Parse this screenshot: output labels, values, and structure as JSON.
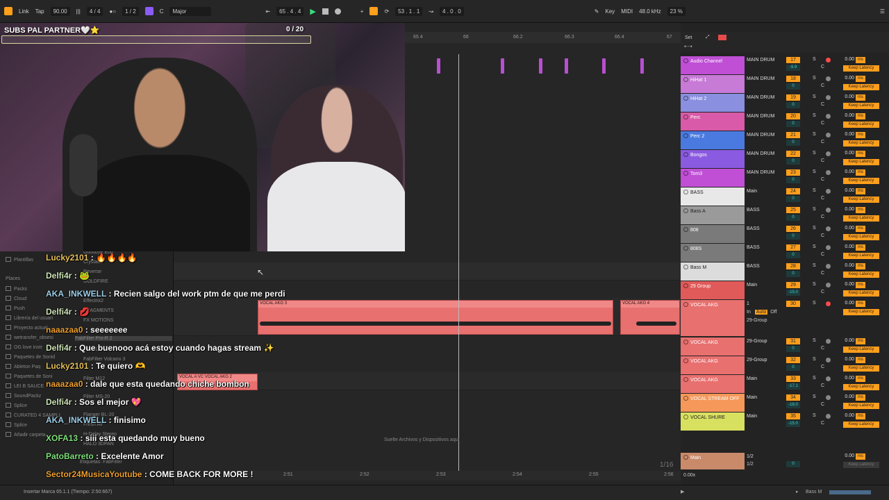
{
  "topbar": {
    "link": "Link",
    "tap": "Tap",
    "tempo": "90.00",
    "time_sig": "4 / 4",
    "quantize": "1 / 2",
    "key": "C",
    "scale": "Major",
    "position": "65 .  4 .  4",
    "loop_start": "53 .  1 .  1",
    "loop_length": "4 .  0 .  0",
    "key_label": "Key",
    "midi_label": "MIDI",
    "sample_rate": "48.0 kHz",
    "cpu": "23 %"
  },
  "webcam": {
    "subs_title": "SUBS PAL PARTNER🤍⭐",
    "subs_count": "0  / 20"
  },
  "ruler": {
    "ticks": [
      "65.4",
      "66",
      "66.2",
      "66.3",
      "66.4",
      "67"
    ],
    "bottom_ticks": [
      "2:51",
      "2:52",
      "2:53",
      "2:54",
      "2:55",
      "2:56"
    ]
  },
  "browser": {
    "items": [
      "Plantillas",
      "Places",
      "Packs",
      "Cloud",
      "Push",
      "Librería del usuari",
      "Proyecto actual",
      "wetransfer_obsesi",
      "OG love instr",
      "Paquetes de Sonid",
      "Ableton Paq",
      "Paquetes de Soni",
      "LEI B SAUCE",
      "SoundPackz",
      "Splice",
      "CURATED 4 SAMPLI",
      "Splice",
      "Añadir carpeta..."
    ],
    "subitems": [
      "Goodbye Ebb",
      "Crystallix",
      "Reverse",
      "GOLDFIRE",
      "Effectrix2",
      "FRAGMENTS",
      "FX MOTIONS",
      "FabFilter Pro-R 2",
      "Filter L",
      "FabFilter Volcano 3",
      "Filter M12",
      "Filter MS-20",
      "Flanger BL-20",
      "Fresh Air",
      "H-Delay Stereo",
      "HALO 3DPAN",
      "Etiquetas: FabFilter"
    ]
  },
  "arrangement": {
    "drop_hint": "Suelte Archivos y Dispositivos aquí",
    "quantize_display": "1/16",
    "clips": [
      "VOCAL AKG 3",
      "VOCAL AKG 4",
      "VOCAL A VC VOCAL AKG 2"
    ]
  },
  "mixer": {
    "set_label": "Set",
    "channels": [
      {
        "name": "Audio Channel",
        "route": "MAIN DRUM",
        "num": "17",
        "val": "-9.9",
        "db": "0.00",
        "lat": "Keep Latency",
        "color": "#c04fd6",
        "arm": true
      },
      {
        "name": "HiHat 1",
        "route": "MAIN DRUM",
        "num": "18",
        "val": "0",
        "db": "0.00",
        "lat": "Keep Latency",
        "color": "#c77ad6",
        "arm": false
      },
      {
        "name": "HiHat 2",
        "route": "MAIN DRUM",
        "num": "19",
        "val": "0",
        "db": "0.00",
        "lat": "Keep Latency",
        "color": "#8a8fe0",
        "arm": false
      },
      {
        "name": "Perc",
        "route": "MAIN DRUM",
        "num": "20",
        "val": "0",
        "db": "0.00",
        "lat": "Keep Latency",
        "color": "#d85aa8",
        "arm": false
      },
      {
        "name": "Perc 2",
        "route": "MAIN DRUM",
        "num": "21",
        "val": "0",
        "db": "0.00",
        "lat": "Keep Latency",
        "color": "#4a7ae0",
        "arm": false
      },
      {
        "name": "Bongos",
        "route": "MAIN DRUM",
        "num": "22",
        "val": "0",
        "db": "0.00",
        "lat": "Keep Latency",
        "color": "#8a5ae0",
        "arm": false
      },
      {
        "name": "Tom3",
        "route": "MAIN DRUM",
        "num": "23",
        "val": "0",
        "db": "0.00",
        "lat": "Keep Latency",
        "color": "#c04fd6",
        "arm": false
      },
      {
        "name": "BASS",
        "route": "Main",
        "num": "24",
        "val": "0",
        "db": "0.00",
        "lat": "Keep Latency",
        "color": "#e8e8e8",
        "arm": false
      },
      {
        "name": "Bass A",
        "route": "BASS",
        "num": "25",
        "val": "0",
        "db": "0.00",
        "lat": "Keep Latency",
        "color": "#9a9a9a",
        "arm": false
      },
      {
        "name": "808",
        "route": "BASS",
        "num": "26",
        "val": "0",
        "db": "0.00",
        "lat": "Keep Latency",
        "color": "#7a7a7a",
        "arm": false
      },
      {
        "name": "808S",
        "route": "BASS",
        "num": "27",
        "val": "0",
        "db": "0.00",
        "lat": "Keep Latency",
        "color": "#7a7a7a",
        "arm": false
      },
      {
        "name": "Bass M",
        "route": "BASS",
        "num": "28",
        "val": "0",
        "db": "0.00",
        "lat": "Keep Latency",
        "color": "#dcdcdc",
        "arm": false
      },
      {
        "name": "29 Group",
        "route": "Main",
        "num": "29",
        "val": "-15.0",
        "db": "0.00",
        "lat": "Keep Latency",
        "color": "#e05a5a",
        "arm": false
      }
    ],
    "vocal_channel": {
      "name": "VOCAL AKG",
      "route": "1",
      "num": "30",
      "in_label": "In",
      "auto_label": "Auto",
      "off_label": "Off",
      "group": "29-Group",
      "db": "0.00",
      "lat": "Keep Latency"
    },
    "more_channels": [
      {
        "name": "VOCAL AKG",
        "route": "29-Group",
        "num": "31",
        "val": "0",
        "db": "0.00",
        "lat": "Keep Latency",
        "color": "#e8706f"
      },
      {
        "name": "VOCAL AKG",
        "route": "29-Group",
        "num": "32",
        "val": "0",
        "db": "0.00",
        "lat": "Keep Latency",
        "color": "#e8706f"
      },
      {
        "name": "VOCAL AKG",
        "route": "Main",
        "num": "33",
        "val": "-17.1",
        "db": "0.00",
        "lat": "Keep Latency",
        "color": "#e8706f"
      },
      {
        "name": "VOCAL STREAM OFF",
        "route": "Main",
        "num": "34",
        "val": "-18.0",
        "db": "0.00",
        "lat": "Keep Latency",
        "color": "#f5985a"
      },
      {
        "name": "VOCAL SHURE",
        "route": "Main",
        "num": "35",
        "val": "-15.0",
        "db": "0.00",
        "lat": "Keep Latency",
        "color": "#d8e060"
      }
    ],
    "main": {
      "name": "Main",
      "route": "1/2",
      "route2": "1/2",
      "val": "0",
      "db": "0.00",
      "lat": "Keep Latency",
      "zoom": "0.00x"
    }
  },
  "chat": [
    {
      "user": "Lucky2101",
      "sep": " : ",
      "msg": "🔥🔥🔥🔥",
      "color": "#e8c15a"
    },
    {
      "user": "Delfi4r",
      "sep": " : ",
      "msg": "🐸",
      "color": "#cfe6b8"
    },
    {
      "user": "AKA_INKWELL",
      "sep": " : ",
      "msg": "Recien salgo del work ptm de que me perdi",
      "color": "#9ecfe8"
    },
    {
      "user": "Delfi4r",
      "sep": " : ",
      "msg": "💋",
      "color": "#cfe6b8"
    },
    {
      "user": "naaazaa0",
      "sep": " : ",
      "msg": "seeeeeee",
      "color": "#f0a030"
    },
    {
      "user": "Delfi4r",
      "sep": " : ",
      "msg": "Que buenooo acá estoy cuando hagas stream ✨",
      "color": "#cfe6b8"
    },
    {
      "user": "Lucky2101",
      "sep": " : ",
      "msg": "Te quiero 🫶",
      "color": "#e8c15a"
    },
    {
      "user": "naaazaa0",
      "sep": " : ",
      "msg": "dale que esta quedando chiche bombon",
      "color": "#f0a030"
    },
    {
      "user": "Delfi4r",
      "sep": " : ",
      "msg": "Sos el mejor 💖",
      "color": "#cfe6b8"
    },
    {
      "user": "AKA_INKWELL",
      "sep": " : ",
      "msg": "finisimo",
      "color": "#9ecfe8"
    },
    {
      "user": "XOFA13",
      "sep": " : ",
      "msg": "siii esta quedando muy bueno",
      "color": "#7ee07a"
    },
    {
      "user": "PatoBarreto",
      "sep": " : ",
      "msg": "Excelente Amor",
      "color": "#7ee07a"
    },
    {
      "user": "Sector24MusicaYoutube",
      "sep": " : ",
      "msg": "COME BACK FOR MORE !",
      "color": "#f0a030"
    }
  ],
  "status": {
    "left": "Insertar Marca 65.1.1 (Tiempo: 2:50:667)",
    "right": "Bass M"
  }
}
